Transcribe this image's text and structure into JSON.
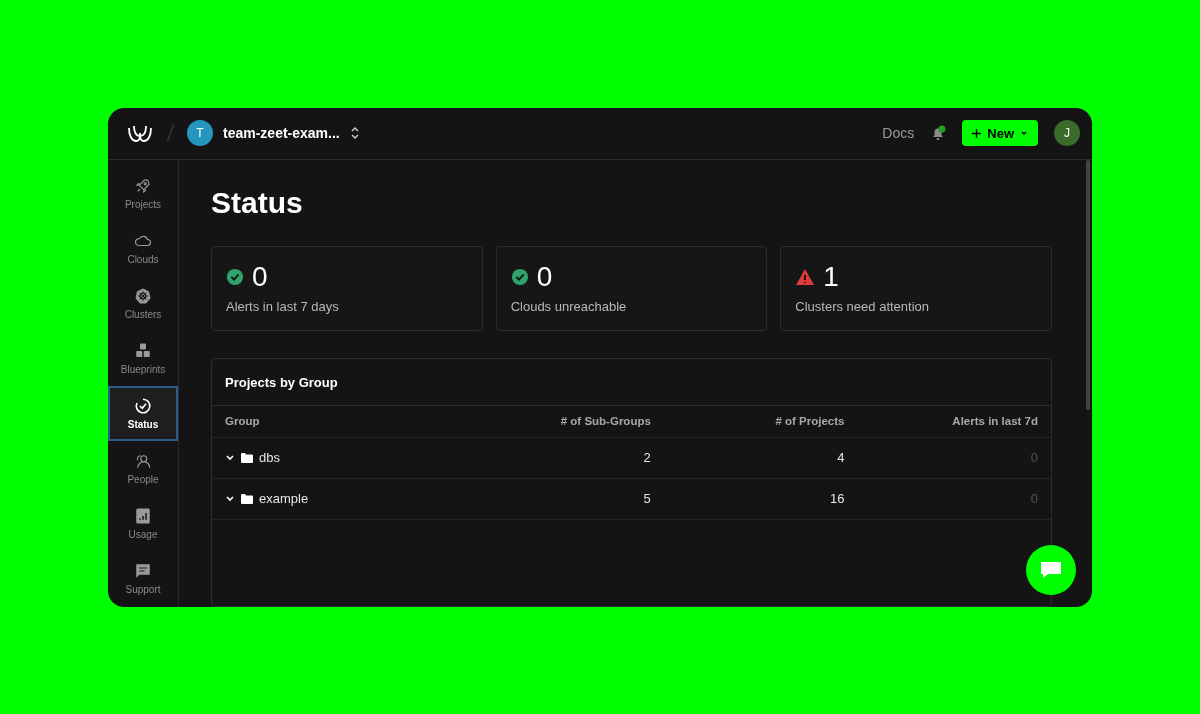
{
  "header": {
    "team_initial": "T",
    "team_name": "team-zeet-exam...",
    "docs_link": "Docs",
    "new_button": "New",
    "user_initial": "J"
  },
  "sidebar": {
    "items": [
      {
        "kind": "projects",
        "label": "Projects",
        "selected": false
      },
      {
        "kind": "clouds",
        "label": "Clouds",
        "selected": false
      },
      {
        "kind": "clusters",
        "label": "Clusters",
        "selected": false
      },
      {
        "kind": "blueprints",
        "label": "Blueprints",
        "selected": false
      },
      {
        "kind": "status",
        "label": "Status",
        "selected": true
      },
      {
        "kind": "people",
        "label": "People",
        "selected": false
      },
      {
        "kind": "usage",
        "label": "Usage",
        "selected": false
      },
      {
        "kind": "support",
        "label": "Support",
        "selected": false
      }
    ]
  },
  "page_title": "Status",
  "stat_cards": [
    {
      "kind": "ok",
      "value": "0",
      "label": "Alerts in last 7 days"
    },
    {
      "kind": "ok",
      "value": "0",
      "label": "Clouds unreachable"
    },
    {
      "kind": "warning",
      "value": "1",
      "label": "Clusters need attention"
    }
  ],
  "table": {
    "title": "Projects by Group",
    "columns": [
      "Group",
      "# of Sub-Groups",
      "# of Projects",
      "Alerts in last 7d"
    ],
    "rows": [
      {
        "group": "dbs",
        "sub_groups": "2",
        "projects": "4",
        "alerts": "0"
      },
      {
        "group": "example",
        "sub_groups": "5",
        "projects": "16",
        "alerts": "0"
      }
    ]
  }
}
